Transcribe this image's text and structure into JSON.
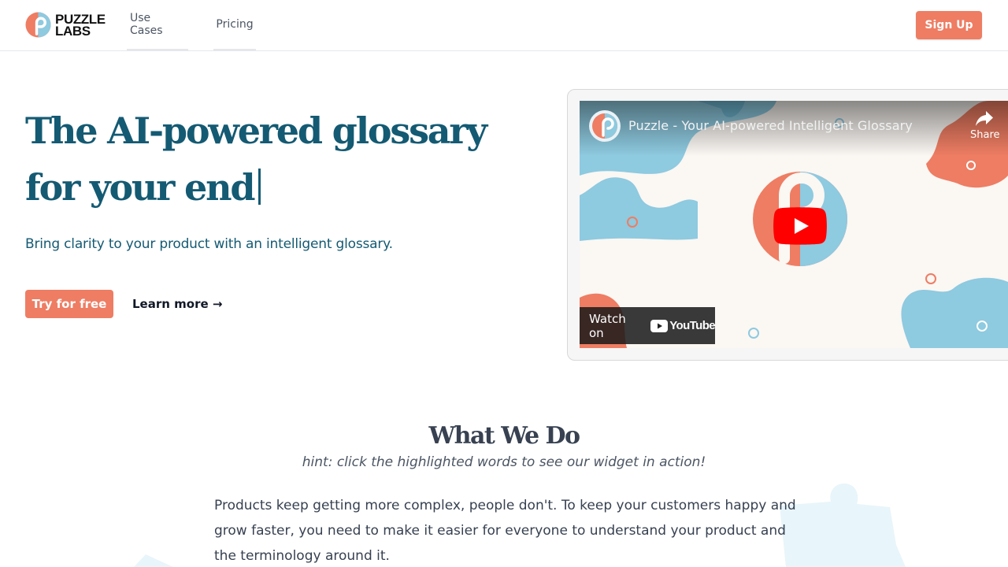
{
  "header": {
    "logo": {
      "line1": "PUZZLE",
      "line2": "LABS"
    },
    "nav": [
      {
        "label": "Use Cases"
      },
      {
        "label": "Pricing"
      }
    ],
    "signup_label": "Sign Up"
  },
  "hero": {
    "title_line1": "The AI-powered glossary",
    "title_line2": "for your end",
    "subtitle": "Bring clarity to your product with an intelligent glossary.",
    "primary_cta": "Try for free",
    "secondary_cta": "Learn more →"
  },
  "video": {
    "title": "Puzzle - Your AI-powered Intelligent Glossary",
    "share_label": "Share",
    "watch_on_label": "Watch on",
    "youtube_wordmark": "YouTube",
    "icons": [
      "channel-avatar",
      "share-icon",
      "play-icon",
      "youtube-logo"
    ]
  },
  "what_we_do": {
    "title": "What We Do",
    "hint": "hint: click the highlighted words to see our widget in action!",
    "body": "Products keep getting more complex, people don't. To keep your customers happy and grow faster, you need to make it easier for everyone to understand your product and the terminology around it."
  },
  "colors": {
    "brand_orange": "#ee7d63",
    "brand_teal": "#145a73",
    "puzzle_blue": "#8ecae0",
    "youtube_red": "#ff0000"
  }
}
